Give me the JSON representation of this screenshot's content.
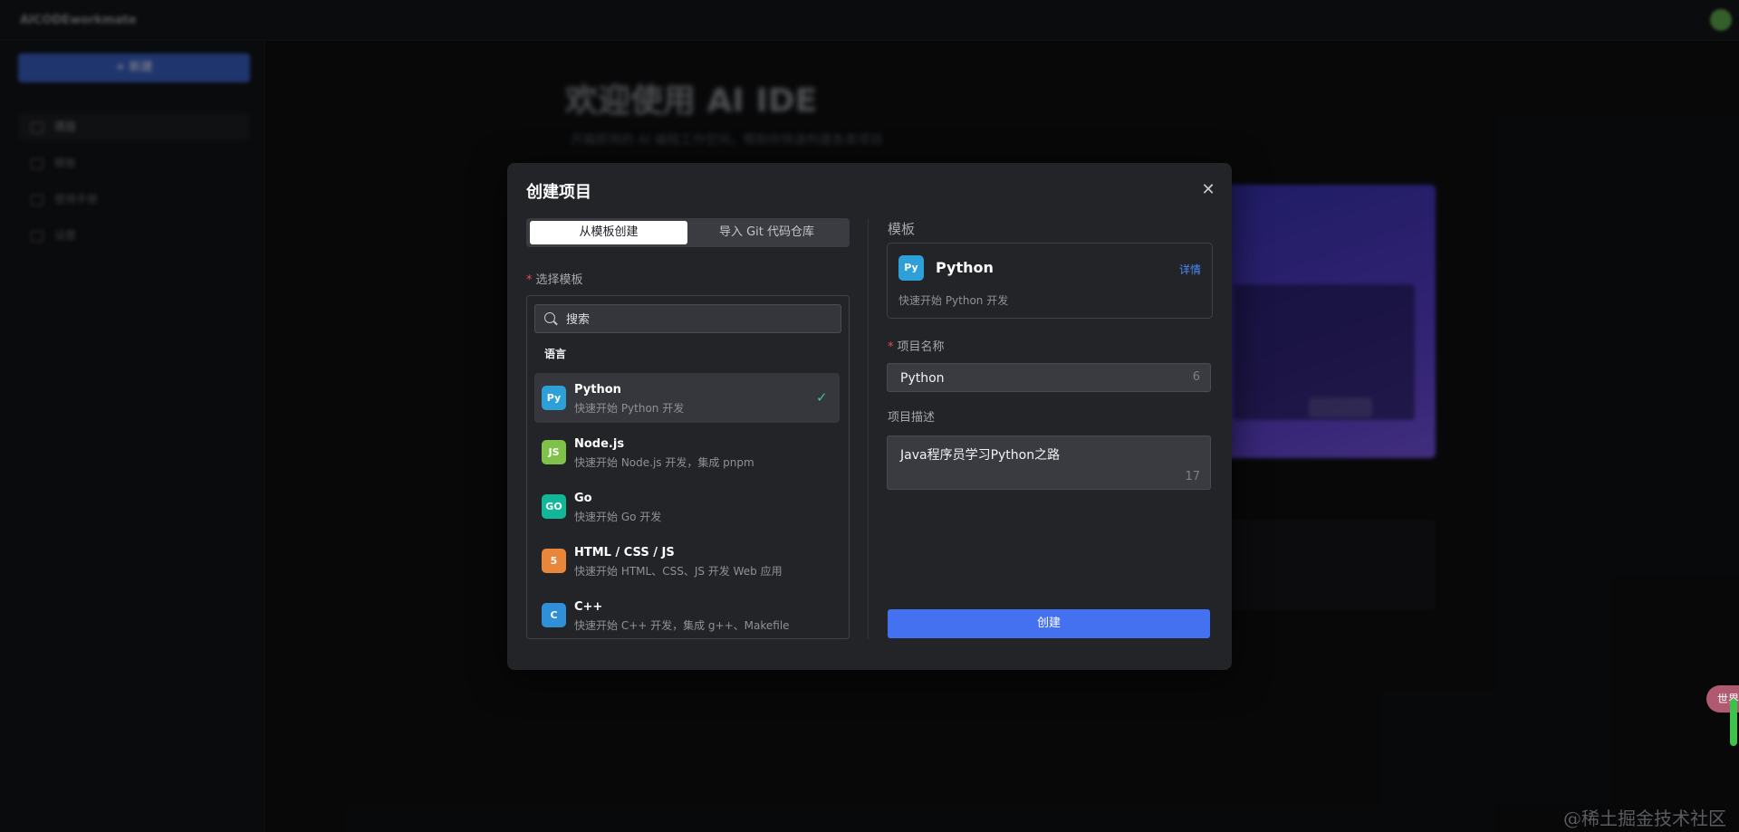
{
  "background": {
    "brand": "AICODEworkmate",
    "new_button": "+ 新建",
    "nav": [
      "项目",
      "模板",
      "使用手册",
      "设置"
    ],
    "hero_title": "欢迎使用 AI IDE",
    "hero_subtitle": "开箱即用的 AI 编程工作空间，帮助你快速构建各类项目"
  },
  "modal": {
    "title": "创建项目",
    "close_symbol": "✕",
    "tabs": [
      {
        "label": "从模板创建",
        "active": true
      },
      {
        "label": "导入 Git 代码仓库",
        "active": false
      }
    ],
    "select_label": "选择模板",
    "search_placeholder": "搜索",
    "group_label": "语言",
    "templates": [
      {
        "name": "Python",
        "desc": "快速开始 Python 开发",
        "icon": "python-icon",
        "icon_text": "Py",
        "color": "#2d9fd9",
        "selected": true
      },
      {
        "name": "Node.js",
        "desc": "快速开始 Node.js 开发，集成 pnpm",
        "icon": "nodejs-icon",
        "icon_text": "JS",
        "color": "#7fc149",
        "selected": false
      },
      {
        "name": "Go",
        "desc": "快速开始 Go 开发",
        "icon": "go-icon",
        "icon_text": "GO",
        "color": "#12b79a",
        "selected": false
      },
      {
        "name": "HTML / CSS / JS",
        "desc": "快速开始 HTML、CSS、JS 开发 Web 应用",
        "icon": "html5-icon",
        "icon_text": "5",
        "color": "#e8873b",
        "selected": false
      },
      {
        "name": "C++",
        "desc": "快速开始 C++ 开发，集成 g++、Makefile",
        "icon": "cpp-icon",
        "icon_text": "C",
        "color": "#2f8fd8",
        "selected": false
      }
    ],
    "right": {
      "template_heading": "模板",
      "card_name": "Python",
      "card_link": "详情",
      "card_desc": "快速开始 Python 开发",
      "name_label": "项目名称",
      "name_value": "Python",
      "name_count": "6",
      "desc_label": "项目描述",
      "desc_value": "Java程序员学习Python之路",
      "desc_count": "17",
      "create_label": "创建"
    }
  },
  "floating": {
    "label": "世界"
  },
  "watermark": "@稀土掘金技术社区",
  "colors": {
    "primary": "#4371f0",
    "check": "#3ec19a",
    "required": "#e34d4d"
  }
}
